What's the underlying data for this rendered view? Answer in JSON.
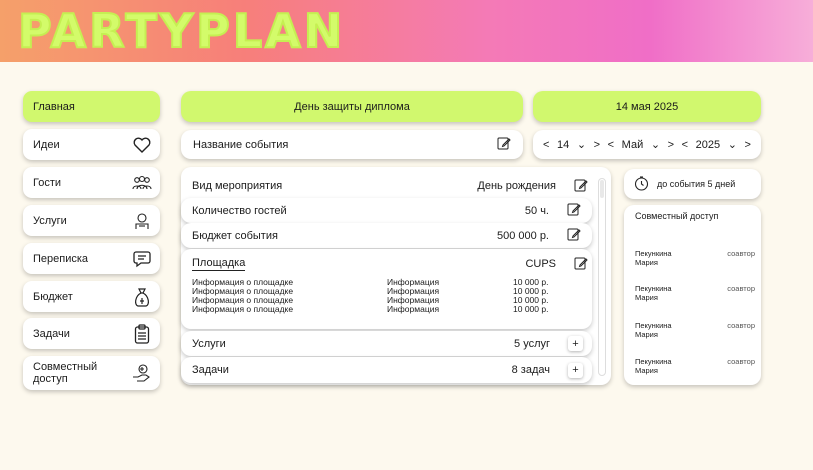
{
  "app": {
    "logo": "PARTYPLAN"
  },
  "nav": [
    {
      "label": "Главная",
      "icon": ""
    },
    {
      "label": "Идеи",
      "icon": "heart-icon"
    },
    {
      "label": "Гости",
      "icon": "guests-icon"
    },
    {
      "label": "Услуги",
      "icon": "services-icon"
    },
    {
      "label": "Переписка",
      "icon": "chat-icon"
    },
    {
      "label": "Бюджет",
      "icon": "money-bag-icon"
    },
    {
      "label": "Задачи",
      "icon": "checklist-icon"
    },
    {
      "label": "Совместный доступ",
      "icon": "shared-access-icon"
    }
  ],
  "event": {
    "title": "День защиты диплома",
    "name_field": "Название события",
    "details": [
      {
        "label": "Вид мероприятия",
        "value": "День рождения"
      },
      {
        "label": "Количество гостей",
        "value": "50 ч."
      },
      {
        "label": "Бюджет события",
        "value": "500 000 р."
      },
      {
        "label": "Площадка",
        "value": "CUPS"
      }
    ],
    "venue_rows": [
      {
        "a": "Информация о площадке",
        "b": "Информация",
        "c": "10 000 р."
      },
      {
        "a": "Информация о площадке",
        "b": "Информация",
        "c": "10 000 р."
      },
      {
        "a": "Информация о площадке",
        "b": "Информация",
        "c": "10 000 р."
      },
      {
        "a": "Информация о площадке",
        "b": "Информация",
        "c": "10 000 р."
      }
    ],
    "services": {
      "label": "Услуги",
      "value": "5 услуг"
    },
    "tasks": {
      "label": "Задачи",
      "value": "8 задач"
    }
  },
  "date": {
    "display": "14 мая 2025",
    "day": "14",
    "month": "Май",
    "year": "2025",
    "prev": "<",
    "next": ">",
    "dropdown": "⌄",
    "countdown": "до события 5 дней"
  },
  "shared": {
    "title": "Совместный доступ",
    "people": [
      {
        "name": "Пекункина Мария",
        "role": "соавтор"
      },
      {
        "name": "Пекункина Мария",
        "role": "соавтор"
      },
      {
        "name": "Пекункина Мария",
        "role": "соавтор"
      },
      {
        "name": "Пекункина Мария",
        "role": "соавтор"
      }
    ]
  },
  "colors": {
    "accent": "#d1f86e",
    "background": "#fdf9ee"
  }
}
